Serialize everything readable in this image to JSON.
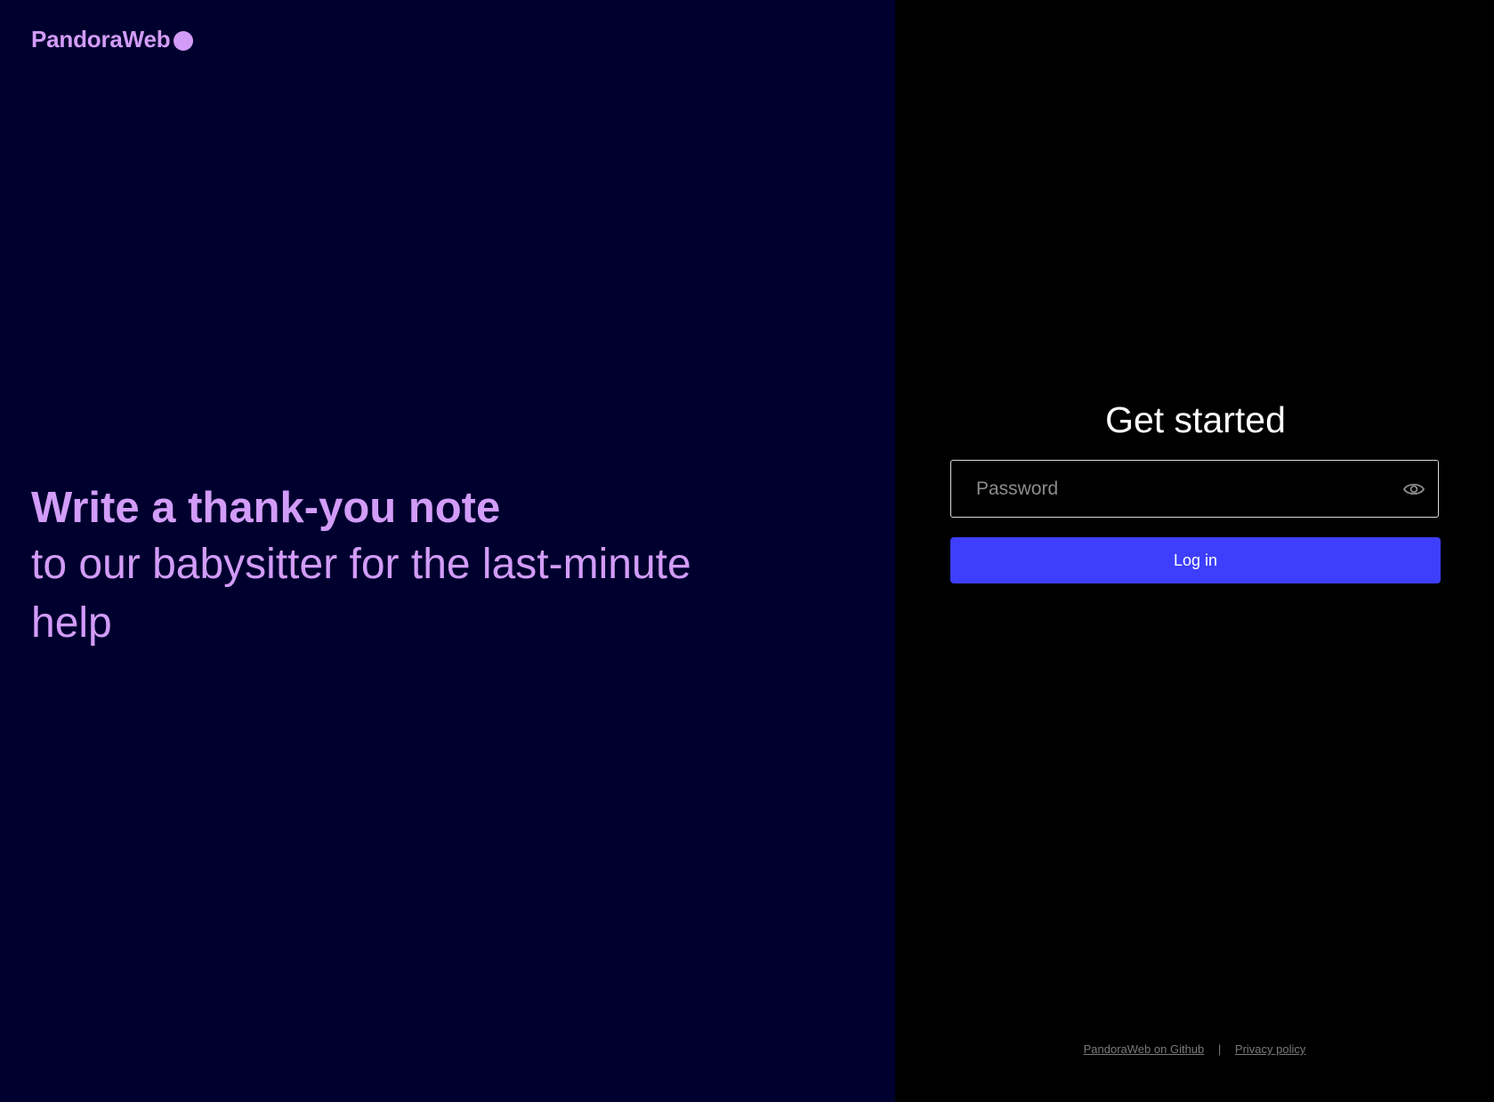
{
  "brand": {
    "name": "PandoraWeb",
    "color": "#d29cf8"
  },
  "hero": {
    "title": "Write a thank-you note",
    "subtitle": "to our babysitter for the last-minute help"
  },
  "login": {
    "title": "Get started",
    "password_placeholder": "Password",
    "password_value": "",
    "toggle_visibility_icon": "eye-icon",
    "button_label": "Log in",
    "button_color": "#3d3ffc"
  },
  "footer": {
    "github_link": "PandoraWeb on Github",
    "separator": "|",
    "privacy_link": "Privacy policy"
  },
  "colors": {
    "left_background": "#00002e",
    "right_background": "#000000"
  }
}
